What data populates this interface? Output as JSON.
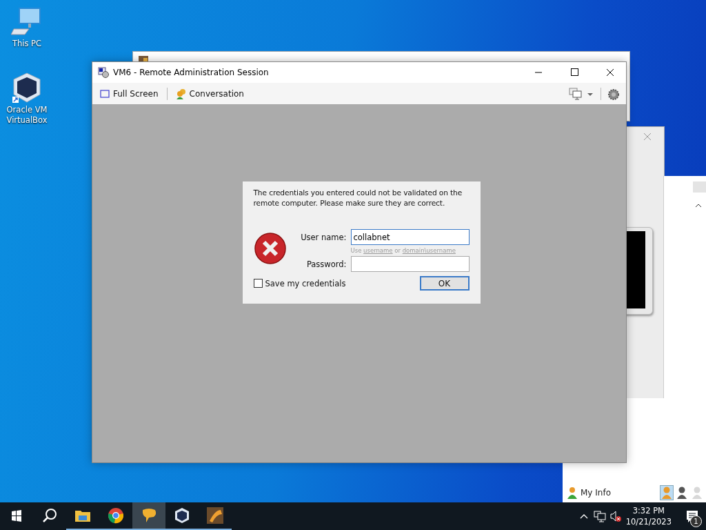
{
  "desktop_icons": [
    {
      "label": "This PC",
      "kind": "computer"
    },
    {
      "label": "Oracle VM VirtualBox",
      "kind": "virtualbox"
    }
  ],
  "window": {
    "title": "VM6 - Remote Administration Session"
  },
  "toolbar": [
    {
      "label": "Full Screen",
      "kind": "fullscreen"
    },
    {
      "label": "Conversation",
      "kind": "conversation"
    }
  ],
  "dialog": {
    "message": "The credentials you entered could not be validated on the remote computer. Please make sure they are correct.",
    "username": {
      "label": "User name:",
      "value": "collabnet"
    },
    "hint": [
      {
        "kind": "text",
        "text": "Use"
      },
      {
        "kind": "link",
        "text": "username"
      },
      {
        "kind": "text",
        "text": "or"
      },
      {
        "kind": "link",
        "text": "domain\\username"
      }
    ],
    "password": {
      "label": "Password:"
    },
    "save_credentials": {
      "label": "Save my credentials",
      "checked": false
    },
    "ok_button": "OK"
  },
  "contacts_panel": {
    "my_info": "My Info",
    "statuses": [
      {
        "color": "#e89a2c",
        "selected": true
      },
      {
        "color": "#555555",
        "selected": false
      },
      {
        "color": "#d8d8d8",
        "selected": false
      }
    ]
  },
  "taskbar": {
    "apps": [
      {
        "kind": "explorer",
        "selected": false
      },
      {
        "kind": "chrome",
        "selected": false
      },
      {
        "kind": "chat",
        "selected": true
      },
      {
        "kind": "virtualbox",
        "selected": false
      },
      {
        "kind": "app",
        "selected": false
      }
    ],
    "time": "3:32 PM",
    "date": "10/21/2023",
    "notifications": "1"
  }
}
